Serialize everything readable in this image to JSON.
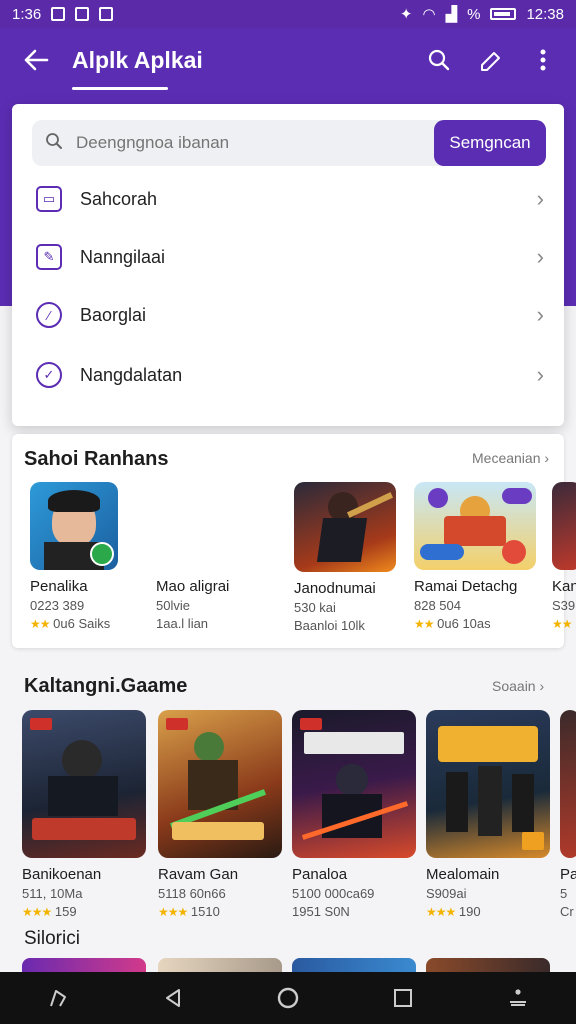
{
  "status_bar": {
    "time_left": "1:36",
    "battery_pct": "%",
    "time_right": "12:38"
  },
  "app_bar": {
    "title": "Alplk Aplkai"
  },
  "search": {
    "placeholder": "Deengngnoa ibanan",
    "button_label": "Semgncan"
  },
  "menu": [
    {
      "label": "Sahcorah",
      "icon": "inbox-icon"
    },
    {
      "label": "Nanngilaai",
      "icon": "edit-icon"
    },
    {
      "label": "Baorglai",
      "icon": "pencil-circle-icon"
    },
    {
      "label": "Nangdalatan",
      "icon": "check-circle-icon"
    }
  ],
  "section1": {
    "title": "Sahoi  Ranhans",
    "more": "Meceanian",
    "items": [
      {
        "name": "Penalika",
        "size": "0223 389",
        "rating": "★★",
        "meta": "0u6 Saiks"
      },
      {
        "name": "Mao aligrai",
        "size": "50lvie",
        "rating": "",
        "meta": "1aa.l lian"
      },
      {
        "name": "Janodnumai",
        "size": "530 kai",
        "rating": "",
        "meta": "Baanloi 10lk"
      },
      {
        "name": "Ramai Detachg",
        "size": "828 504",
        "rating": "★★",
        "meta": "0u6 10as"
      },
      {
        "name": "Kan",
        "size": "S39",
        "rating": "★★",
        "meta": ""
      }
    ]
  },
  "section2": {
    "title": "Kaltangni.Gaame",
    "more": "Soaain",
    "items": [
      {
        "name": "Banikoenan",
        "size": "511, 10Ma",
        "rating": "★★★",
        "meta": "159"
      },
      {
        "name": "Ravam Gan",
        "size": "5118 60n66",
        "rating": "★★★",
        "meta": "1510"
      },
      {
        "name": "Panaloa",
        "size": "5100 000ca69",
        "rating": "",
        "meta": "1951 S0N"
      },
      {
        "name": "Mealomain",
        "size": "S909ai",
        "rating": "★★★",
        "meta": "190"
      },
      {
        "name": "Pa",
        "size": "5",
        "rating": "",
        "meta": "Cr"
      }
    ]
  },
  "section3": {
    "title": "Silorici"
  },
  "colors": {
    "primary": "#5b2db3",
    "star": "#f3b400",
    "navbar": "#111111"
  }
}
